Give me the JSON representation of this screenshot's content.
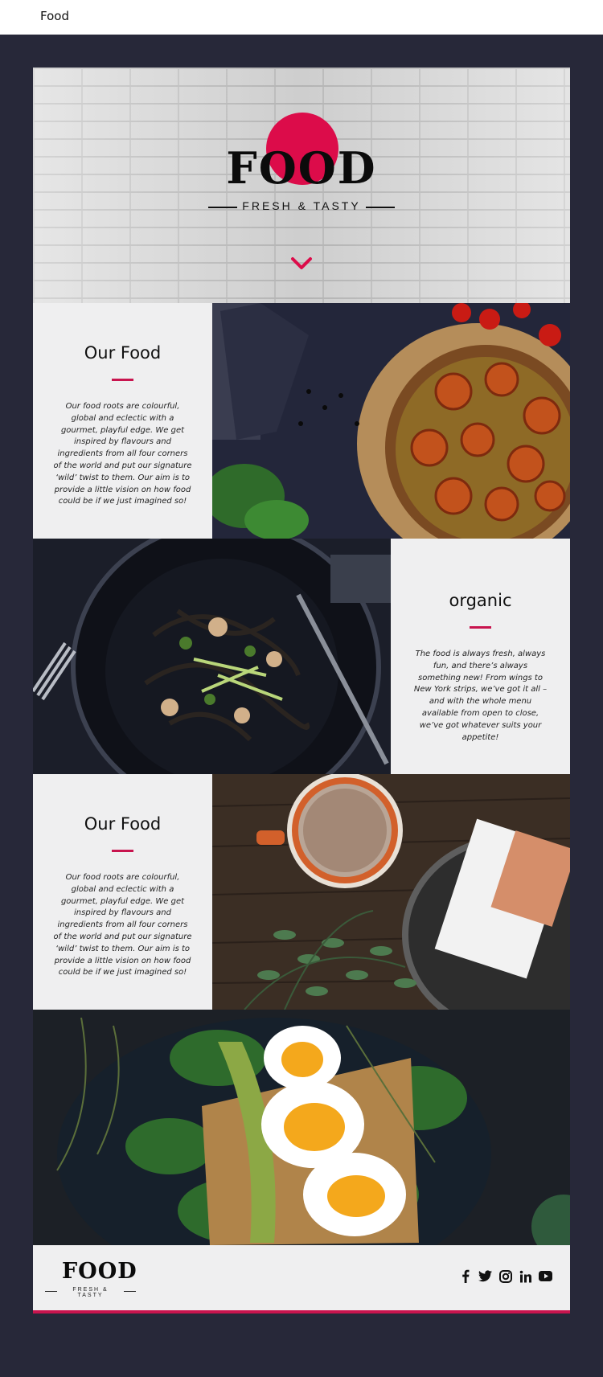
{
  "topbar": {
    "brand": "Food"
  },
  "hero": {
    "logo": "FOOD",
    "tagline": "FRESH & TASTY",
    "accent_color": "#dc0c4a",
    "scroll_icon": "chevron-down-icon"
  },
  "sections": [
    {
      "heading": "Our Food",
      "body": "Our food roots are colourful, global and eclectic with a gourmet, playful edge. We get inspired by flavours and ingredients from all four corners of the world and put our signature ‘wild’ twist to them. Our aim is to provide a little vision on how food could be if we just imagined so!"
    },
    {
      "heading": "organic",
      "body": "The food is always fresh, always fun, and there’s always something new! From wings to New York strips, we’ve got it all – and with the whole menu available from open to close, we’ve got whatever suits your appetite!"
    },
    {
      "heading": "Our Food",
      "body": "Our food roots are colourful, global and eclectic with a gourmet, playful edge. We get inspired by flavours and ingredients from all four corners of the world and put our signature ‘wild’ twist to them. Our aim is to provide a little vision on how food could be if we just imagined so!"
    }
  ],
  "footer": {
    "logo": "FOOD",
    "tagline": "FRESH & TASTY",
    "social": [
      "facebook-icon",
      "twitter-icon",
      "instagram-icon",
      "linkedin-icon",
      "youtube-icon"
    ]
  },
  "colors": {
    "page_bg": "#272839",
    "panel_bg": "#efeff0",
    "accent": "#c8144e"
  }
}
